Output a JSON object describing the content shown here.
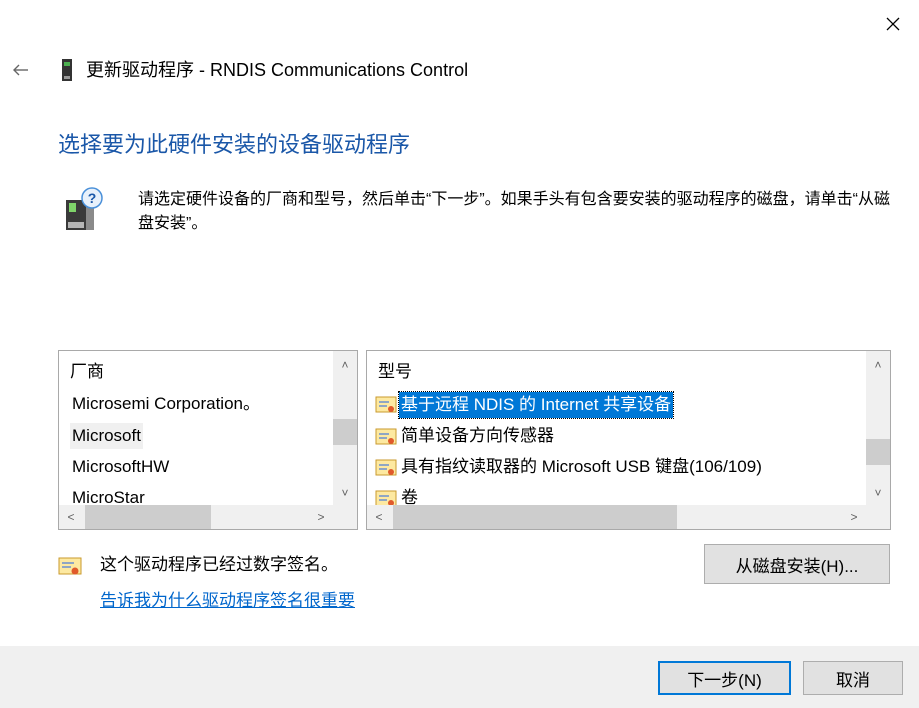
{
  "window": {
    "title": "更新驱动程序 - RNDIS Communications Control"
  },
  "heading": "选择要为此硬件安装的设备驱动程序",
  "description": "请选定硬件设备的厂商和型号，然后单击“下一步”。如果手头有包含要安装的驱动程序的磁盘，请单击“从磁盘安装”。",
  "manufacturers": {
    "header": "厂商",
    "items": [
      {
        "label": "Microsemi Corporation。"
      },
      {
        "label": "Microsoft"
      },
      {
        "label": "MicrosoftHW"
      },
      {
        "label": "MicroStar"
      }
    ]
  },
  "models": {
    "header": "型号",
    "items": [
      {
        "label": "基于远程 NDIS 的 Internet 共享设备"
      },
      {
        "label": "简单设备方向传感器"
      },
      {
        "label": "具有指纹读取器的 Microsoft USB 键盘(106/109)"
      },
      {
        "label": "卷"
      }
    ]
  },
  "signature": {
    "status_text": "这个驱动程序已经过数字签名。",
    "link_text": "告诉我为什么驱动程序签名很重要"
  },
  "buttons": {
    "have_disk": "从磁盘安装(H)...",
    "next": "下一步(N)",
    "cancel": "取消"
  },
  "scroll_arrows": {
    "up": "˄",
    "down": "˅",
    "left": "<",
    "right": ">"
  },
  "colors": {
    "heading": "#1a57a8",
    "selection": "#0078d7",
    "link": "#0066cc",
    "footer": "#f0f0f0"
  }
}
